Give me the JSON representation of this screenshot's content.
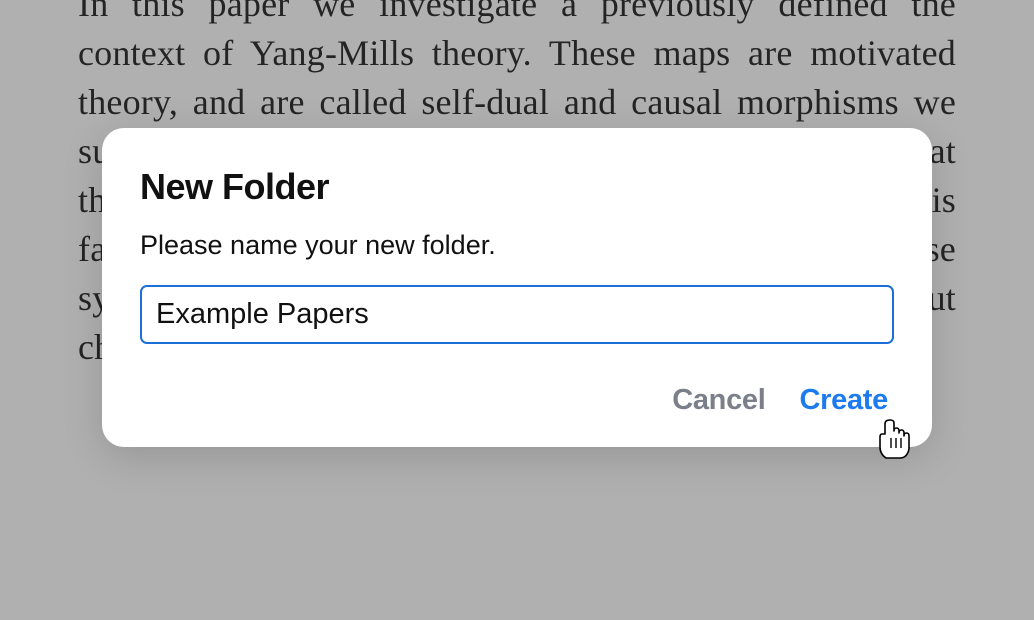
{
  "document": {
    "text": "In this paper we investigate a previously defined the context of Yang-Mills theory. These maps are motivated theory, and are called self-dual and causal morphisms we summarize connection that In the map which shows that these generalizations describe null symmetries of this family version of the YM. It is likely that some of these symmetries are related across the different cases, but characterizing these relationships investigation."
  },
  "dialog": {
    "title": "New Folder",
    "prompt": "Please name your new folder.",
    "input_value": "Example Papers",
    "cancel_label": "Cancel",
    "create_label": "Create"
  }
}
